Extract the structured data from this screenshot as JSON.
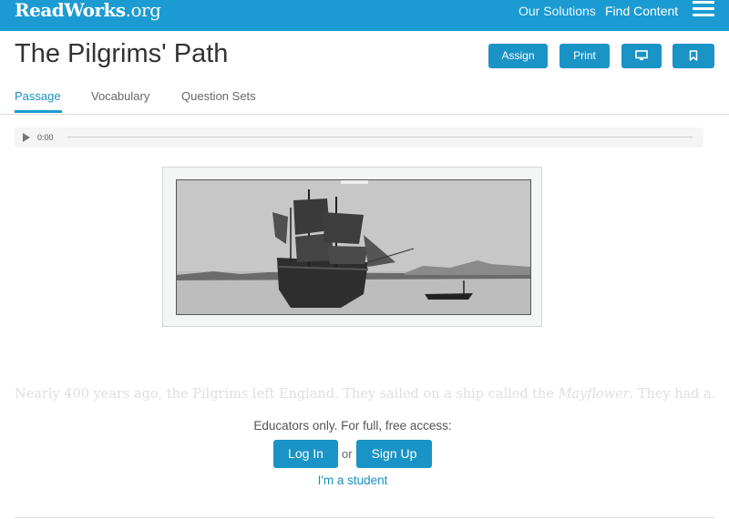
{
  "header": {
    "logo_main": "ReadWorks",
    "logo_tld": ".org",
    "nav": [
      "Our Solutions",
      "Find Content"
    ],
    "menu_icon": "hamburger-menu-icon",
    "brand_color": "#1b9bd1"
  },
  "page": {
    "title": "The Pilgrims' Path",
    "actions": {
      "assign": "Assign",
      "print": "Print",
      "present_icon": "monitor-icon",
      "bookmark_icon": "bookmark-icon"
    }
  },
  "tabs": [
    "Passage",
    "Vocabulary",
    "Question Sets"
  ],
  "active_tab": "Passage",
  "audio": {
    "play_icon": "play-icon",
    "time": "0:00"
  },
  "passage": {
    "image_alt": "ship-photo",
    "excerpt_before": "Nearly 400 years ago, the Pilgrims left England. They sailed on a ship called the ",
    "ship_name": "Mayflower",
    "excerpt_after": ". They had a..."
  },
  "access": {
    "prompt": "Educators only. For full, free access:",
    "login": "Log In",
    "or": "or",
    "signup": "Sign Up",
    "student": "I'm a student"
  }
}
